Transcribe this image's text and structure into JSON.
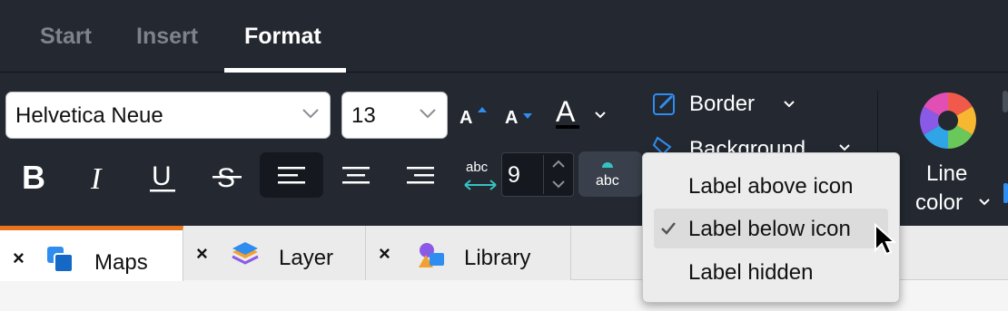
{
  "ribbon_tabs": [
    {
      "label": "Start"
    },
    {
      "label": "Insert"
    },
    {
      "label": "Format"
    }
  ],
  "font": {
    "family": "Helvetica Neue",
    "size": "13"
  },
  "spacing_value": "9",
  "border_label": "Border",
  "background_label": "Background",
  "line_color": {
    "line1": "Line",
    "line2": "color"
  },
  "abc_label": "abc",
  "abc_small_label": "abc",
  "menu": {
    "items": [
      {
        "label": "Label above icon",
        "checked": false
      },
      {
        "label": "Label below icon",
        "checked": true
      },
      {
        "label": "Label hidden",
        "checked": false
      }
    ]
  },
  "doc_tabs": [
    {
      "label": "Maps",
      "close": "×"
    },
    {
      "label": "Layer",
      "close": "×"
    },
    {
      "label": "Library",
      "close": "×"
    }
  ],
  "colors": {
    "ribbon_bg": "#232831",
    "accent_orange": "#e8741e",
    "spacing_teal": "#35c3c1"
  }
}
